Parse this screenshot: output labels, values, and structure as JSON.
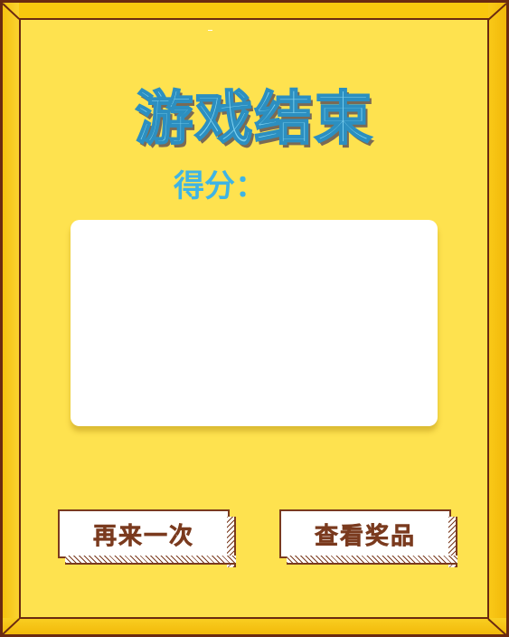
{
  "title": "游戏结束",
  "score": {
    "label": "得分："
  },
  "buttons": {
    "replay_label": "再来一次",
    "prizes_label": "查看奖品"
  },
  "colors": {
    "background": "#fde34f",
    "frame": "#f9c80e",
    "border": "#6b2a10",
    "title": "#7fd2f0",
    "score_label": "#3fb4e4",
    "button_text": "#7a3a1e"
  }
}
